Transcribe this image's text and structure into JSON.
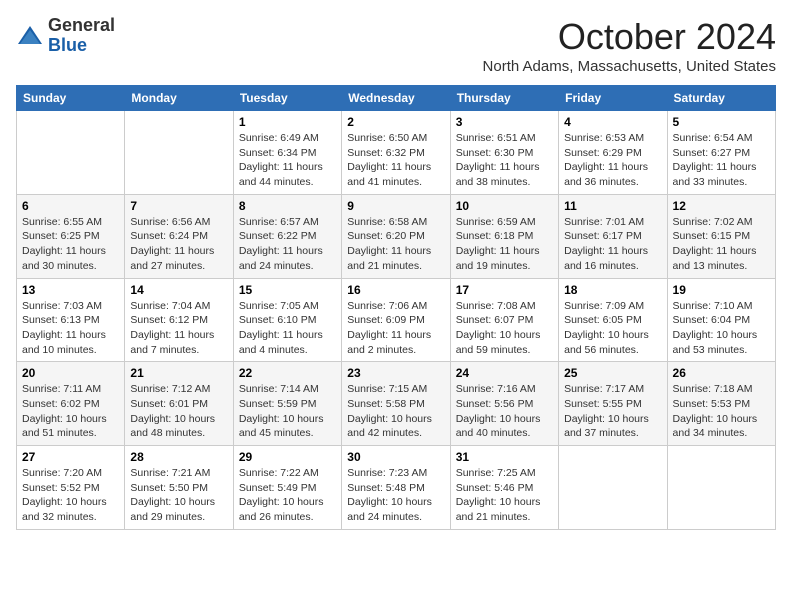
{
  "header": {
    "logo": {
      "general": "General",
      "blue": "Blue"
    },
    "title": "October 2024",
    "location": "North Adams, Massachusetts, United States"
  },
  "weekdays": [
    "Sunday",
    "Monday",
    "Tuesday",
    "Wednesday",
    "Thursday",
    "Friday",
    "Saturday"
  ],
  "weeks": [
    [
      {
        "day": "",
        "sunrise": "",
        "sunset": "",
        "daylight": ""
      },
      {
        "day": "",
        "sunrise": "",
        "sunset": "",
        "daylight": ""
      },
      {
        "day": "1",
        "sunrise": "Sunrise: 6:49 AM",
        "sunset": "Sunset: 6:34 PM",
        "daylight": "Daylight: 11 hours and 44 minutes."
      },
      {
        "day": "2",
        "sunrise": "Sunrise: 6:50 AM",
        "sunset": "Sunset: 6:32 PM",
        "daylight": "Daylight: 11 hours and 41 minutes."
      },
      {
        "day": "3",
        "sunrise": "Sunrise: 6:51 AM",
        "sunset": "Sunset: 6:30 PM",
        "daylight": "Daylight: 11 hours and 38 minutes."
      },
      {
        "day": "4",
        "sunrise": "Sunrise: 6:53 AM",
        "sunset": "Sunset: 6:29 PM",
        "daylight": "Daylight: 11 hours and 36 minutes."
      },
      {
        "day": "5",
        "sunrise": "Sunrise: 6:54 AM",
        "sunset": "Sunset: 6:27 PM",
        "daylight": "Daylight: 11 hours and 33 minutes."
      }
    ],
    [
      {
        "day": "6",
        "sunrise": "Sunrise: 6:55 AM",
        "sunset": "Sunset: 6:25 PM",
        "daylight": "Daylight: 11 hours and 30 minutes."
      },
      {
        "day": "7",
        "sunrise": "Sunrise: 6:56 AM",
        "sunset": "Sunset: 6:24 PM",
        "daylight": "Daylight: 11 hours and 27 minutes."
      },
      {
        "day": "8",
        "sunrise": "Sunrise: 6:57 AM",
        "sunset": "Sunset: 6:22 PM",
        "daylight": "Daylight: 11 hours and 24 minutes."
      },
      {
        "day": "9",
        "sunrise": "Sunrise: 6:58 AM",
        "sunset": "Sunset: 6:20 PM",
        "daylight": "Daylight: 11 hours and 21 minutes."
      },
      {
        "day": "10",
        "sunrise": "Sunrise: 6:59 AM",
        "sunset": "Sunset: 6:18 PM",
        "daylight": "Daylight: 11 hours and 19 minutes."
      },
      {
        "day": "11",
        "sunrise": "Sunrise: 7:01 AM",
        "sunset": "Sunset: 6:17 PM",
        "daylight": "Daylight: 11 hours and 16 minutes."
      },
      {
        "day": "12",
        "sunrise": "Sunrise: 7:02 AM",
        "sunset": "Sunset: 6:15 PM",
        "daylight": "Daylight: 11 hours and 13 minutes."
      }
    ],
    [
      {
        "day": "13",
        "sunrise": "Sunrise: 7:03 AM",
        "sunset": "Sunset: 6:13 PM",
        "daylight": "Daylight: 11 hours and 10 minutes."
      },
      {
        "day": "14",
        "sunrise": "Sunrise: 7:04 AM",
        "sunset": "Sunset: 6:12 PM",
        "daylight": "Daylight: 11 hours and 7 minutes."
      },
      {
        "day": "15",
        "sunrise": "Sunrise: 7:05 AM",
        "sunset": "Sunset: 6:10 PM",
        "daylight": "Daylight: 11 hours and 4 minutes."
      },
      {
        "day": "16",
        "sunrise": "Sunrise: 7:06 AM",
        "sunset": "Sunset: 6:09 PM",
        "daylight": "Daylight: 11 hours and 2 minutes."
      },
      {
        "day": "17",
        "sunrise": "Sunrise: 7:08 AM",
        "sunset": "Sunset: 6:07 PM",
        "daylight": "Daylight: 10 hours and 59 minutes."
      },
      {
        "day": "18",
        "sunrise": "Sunrise: 7:09 AM",
        "sunset": "Sunset: 6:05 PM",
        "daylight": "Daylight: 10 hours and 56 minutes."
      },
      {
        "day": "19",
        "sunrise": "Sunrise: 7:10 AM",
        "sunset": "Sunset: 6:04 PM",
        "daylight": "Daylight: 10 hours and 53 minutes."
      }
    ],
    [
      {
        "day": "20",
        "sunrise": "Sunrise: 7:11 AM",
        "sunset": "Sunset: 6:02 PM",
        "daylight": "Daylight: 10 hours and 51 minutes."
      },
      {
        "day": "21",
        "sunrise": "Sunrise: 7:12 AM",
        "sunset": "Sunset: 6:01 PM",
        "daylight": "Daylight: 10 hours and 48 minutes."
      },
      {
        "day": "22",
        "sunrise": "Sunrise: 7:14 AM",
        "sunset": "Sunset: 5:59 PM",
        "daylight": "Daylight: 10 hours and 45 minutes."
      },
      {
        "day": "23",
        "sunrise": "Sunrise: 7:15 AM",
        "sunset": "Sunset: 5:58 PM",
        "daylight": "Daylight: 10 hours and 42 minutes."
      },
      {
        "day": "24",
        "sunrise": "Sunrise: 7:16 AM",
        "sunset": "Sunset: 5:56 PM",
        "daylight": "Daylight: 10 hours and 40 minutes."
      },
      {
        "day": "25",
        "sunrise": "Sunrise: 7:17 AM",
        "sunset": "Sunset: 5:55 PM",
        "daylight": "Daylight: 10 hours and 37 minutes."
      },
      {
        "day": "26",
        "sunrise": "Sunrise: 7:18 AM",
        "sunset": "Sunset: 5:53 PM",
        "daylight": "Daylight: 10 hours and 34 minutes."
      }
    ],
    [
      {
        "day": "27",
        "sunrise": "Sunrise: 7:20 AM",
        "sunset": "Sunset: 5:52 PM",
        "daylight": "Daylight: 10 hours and 32 minutes."
      },
      {
        "day": "28",
        "sunrise": "Sunrise: 7:21 AM",
        "sunset": "Sunset: 5:50 PM",
        "daylight": "Daylight: 10 hours and 29 minutes."
      },
      {
        "day": "29",
        "sunrise": "Sunrise: 7:22 AM",
        "sunset": "Sunset: 5:49 PM",
        "daylight": "Daylight: 10 hours and 26 minutes."
      },
      {
        "day": "30",
        "sunrise": "Sunrise: 7:23 AM",
        "sunset": "Sunset: 5:48 PM",
        "daylight": "Daylight: 10 hours and 24 minutes."
      },
      {
        "day": "31",
        "sunrise": "Sunrise: 7:25 AM",
        "sunset": "Sunset: 5:46 PM",
        "daylight": "Daylight: 10 hours and 21 minutes."
      },
      {
        "day": "",
        "sunrise": "",
        "sunset": "",
        "daylight": ""
      },
      {
        "day": "",
        "sunrise": "",
        "sunset": "",
        "daylight": ""
      }
    ]
  ]
}
